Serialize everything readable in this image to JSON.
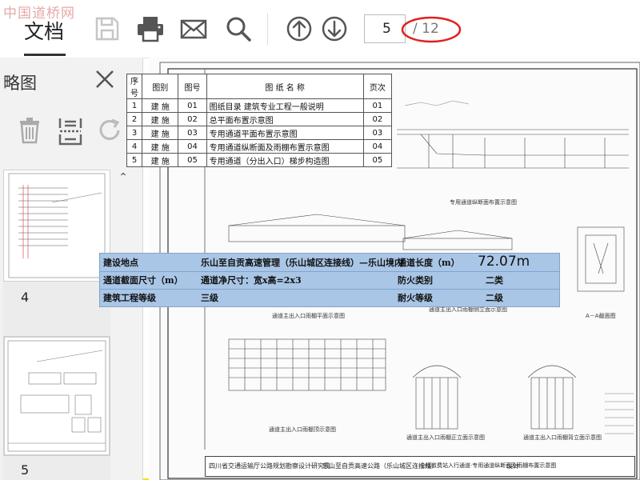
{
  "watermark": "中国道桥网",
  "toolbar": {
    "doc_tab": "文档",
    "current_page": "5",
    "page_total": "/ 12",
    "icons": [
      "save-icon",
      "print-icon",
      "mail-icon",
      "search-icon",
      "arrow-up-icon",
      "arrow-down-icon"
    ]
  },
  "sidebar": {
    "title": "略图",
    "thumbnails": [
      {
        "label": "4"
      },
      {
        "label": "5"
      }
    ]
  },
  "index_table": {
    "headers": [
      "序号",
      "图别",
      "图号",
      "图 纸 名 称",
      "页次"
    ],
    "rows": [
      {
        "no": "1",
        "cat": "建 施",
        "num": "01",
        "name": "图纸目录  建筑专业工程一般说明",
        "page": "01"
      },
      {
        "no": "2",
        "cat": "建 施",
        "num": "02",
        "name": "总平面布置示意图",
        "page": "02"
      },
      {
        "no": "3",
        "cat": "建 施",
        "num": "03",
        "name": "专用通道平面布置示意图",
        "page": "03"
      },
      {
        "no": "4",
        "cat": "建 施",
        "num": "04",
        "name": "专用通道纵断面及雨棚布置示意图",
        "page": "04"
      },
      {
        "no": "5",
        "cat": "建 施",
        "num": "05",
        "name": "专用通道（分出入口）梯步构造图",
        "page": "05"
      }
    ]
  },
  "info_table": {
    "r1": {
      "label1": "建设地点",
      "value1": "乐山至自贡高速管理（乐山城区连接线）—乐山境内",
      "label2": "通道长度（m）",
      "value2": "72.07m"
    },
    "r2": {
      "label1": "通道截面尺寸（m）",
      "value1": "通道净尺寸：宽x高=2x3",
      "label2": "防火类别",
      "value2": "二类"
    },
    "r3": {
      "label1": "建筑工程等级",
      "value1": "三级",
      "label2": "耐火等级",
      "value2": "二级"
    }
  },
  "captions": {
    "longitudinal": "专用通道纵断面布置示意图",
    "canopy_plan": "通道主出入口雨棚平面示意图",
    "canopy_elev_label": "通道主出入口雨棚侧立面示意图",
    "section_aa": "A－A截面图",
    "canopy_top": "通道主出入口雨棚顶示意图",
    "canopy_front": "通道主出入口雨棚正立面示意图",
    "canopy_back": "通道主出入口雨棚背立面示意图"
  },
  "title_block": {
    "org": "四川省交通运输厅公路规划勘察设计研究院",
    "project": "乐山至自贡高速公路（乐山城区连接线）",
    "drawing": "全幅收费站入行通道·专用通道纵断面及雨棚布置示意图",
    "design": "设计"
  }
}
